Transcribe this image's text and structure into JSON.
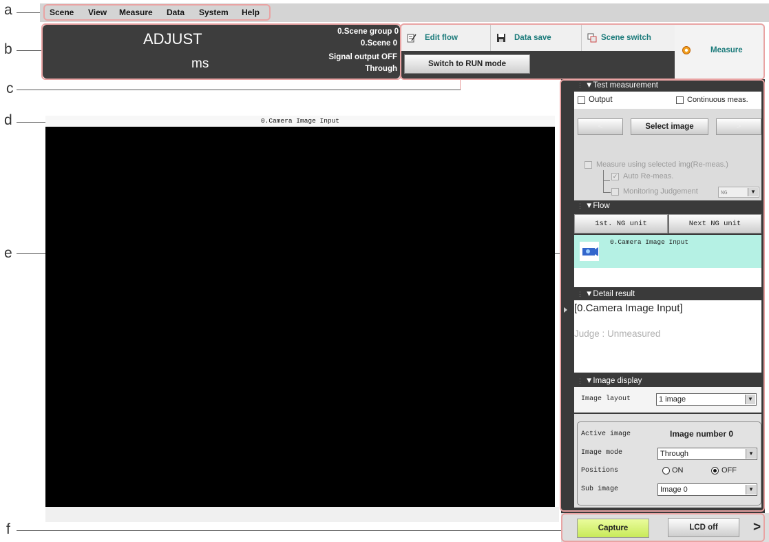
{
  "annotations": [
    "a",
    "b",
    "c",
    "d",
    "e",
    "f"
  ],
  "menu": [
    "Scene",
    "View",
    "Measure",
    "Data",
    "System",
    "Help"
  ],
  "status": {
    "mode": "ADJUST",
    "unit": "ms",
    "scene_group": "0.Scene group 0",
    "scene": "0.Scene 0",
    "signal_output": "Signal output OFF",
    "through": "Through"
  },
  "toolbar": {
    "edit_flow": "Edit flow",
    "data_save": "Data save",
    "scene_switch": "Scene switch",
    "run_mode": "Switch to RUN mode",
    "measure": "Measure"
  },
  "image_view": {
    "title": "0.Camera Image Input"
  },
  "test_measurement": {
    "header": "Test measurement",
    "output": "Output",
    "continuous": "Continuous meas.",
    "prev": "<",
    "select_image": "Select image",
    "next": ">",
    "remeas": "Measure using selected img(Re-meas.)",
    "auto_remeas": "Auto Re-meas.",
    "monitoring": "Monitoring Judgement",
    "judgement_value": "NG"
  },
  "flow": {
    "header": "Flow",
    "first_ng": "1st. NG unit",
    "next_ng": "Next NG unit",
    "item": "0.Camera Image Input"
  },
  "detail_result": {
    "header": "Detail result",
    "name": "[0.Camera Image Input]",
    "judge": "Judge : Unmeasured"
  },
  "image_display": {
    "header": "Image display",
    "layout_label": "Image layout",
    "layout_value": "1 image",
    "active_label": "Active image",
    "active_value": "Image number 0",
    "mode_label": "Image mode",
    "mode_value": "Through",
    "positions_label": "Positions",
    "on_label": "ON",
    "off_label": "OFF",
    "sub_label": "Sub image",
    "sub_value": "Image 0"
  },
  "bottom": {
    "capture": "Capture",
    "lcd_off": "LCD off",
    "more": ">"
  },
  "colors": {
    "dark_panel": "#3d3d3d",
    "teal_text": "#1c7b7b",
    "flow_highlight": "#b5f1e4",
    "capture_green": "#d6f27a",
    "annotation_box": "#e9a3a3"
  }
}
